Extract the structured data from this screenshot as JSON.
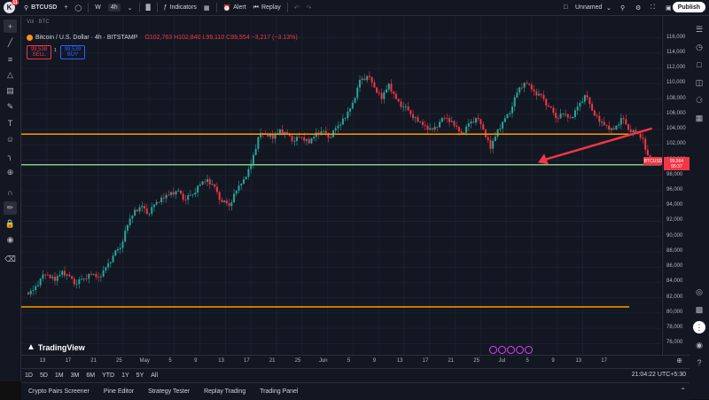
{
  "topbar": {
    "logo_letter": "K",
    "logo_badge": "11",
    "symbol": "BTCUSD",
    "tf_w": "W",
    "tf_active": "4h",
    "indicators": "Indicators",
    "alert": "Alert",
    "replay": "Replay",
    "layout_name": "Unnamed",
    "publish": "Publish"
  },
  "legend": {
    "title": "Bitcoin / U.S. Dollar · 4h · BITSTAMP",
    "o": "O102,763",
    "h": "H102,840",
    "l": "L99,110",
    "c": "C99,554 −3,217 (−3.13%)",
    "vol": "Vol · BTC"
  },
  "trade": {
    "sell_price": "99,538",
    "sell_label": "SELL",
    "buy_price": "99,539",
    "buy_label": "BUY",
    "spread": "1"
  },
  "price_axis": {
    "ticks": [
      "116,000",
      "114,000",
      "112,000",
      "110,000",
      "108,000",
      "106,000",
      "104,000",
      "102,000",
      "100,000",
      "98,000",
      "96,000",
      "94,000",
      "92,000",
      "90,000",
      "88,000",
      "86,000",
      "84,000",
      "82,000",
      "80,000",
      "78,000",
      "76,000"
    ]
  },
  "price_tag": {
    "symbol": "BTCUSD",
    "price": "99,564",
    "countdown": "55:37"
  },
  "date_axis": {
    "labels": [
      "13",
      "17",
      "21",
      "25",
      "May",
      "5",
      "9",
      "13",
      "17",
      "21",
      "25",
      "Jun",
      "5",
      "9",
      "13",
      "17",
      "21",
      "25",
      "Jul",
      "5",
      "9",
      "13",
      "17"
    ]
  },
  "range_bar": {
    "ranges": [
      "1D",
      "5D",
      "1M",
      "3M",
      "6M",
      "YTD",
      "1Y",
      "5Y",
      "All"
    ],
    "clock": "21:04:22 UTC+5:30"
  },
  "bottom_tabs": [
    "Crypto Pairs Screener",
    "Pine Editor",
    "Strategy Tester",
    "Replay Trading",
    "Trading Panel"
  ],
  "watermark": "TradingView",
  "colors": {
    "bg": "#131722",
    "up": "#26a69a",
    "down": "#f23645",
    "orange_line": "#ff9800",
    "green_line": "#81c784"
  },
  "chart_data": {
    "type": "candlestick",
    "symbol": "BTCUSD",
    "interval": "4h",
    "ylim": [
      75000,
      117000
    ],
    "horizontal_lines": [
      {
        "price": 103400,
        "color": "#ff9800"
      },
      {
        "price": 99400,
        "color": "#81c784"
      },
      {
        "price": 80800,
        "color": "#ff9800"
      }
    ],
    "arrow": {
      "from": [
        106000,
        103800
      ],
      "to_label": "down"
    },
    "closes": [
      83000,
      84500,
      85000,
      84200,
      85500,
      84800,
      83800,
      84500,
      85000,
      84700,
      86000,
      87500,
      88500,
      91500,
      93500,
      94000,
      93000,
      94500,
      95000,
      95800,
      96000,
      94800,
      95500,
      96800,
      97500,
      96500,
      94500,
      94000,
      96000,
      97500,
      99500,
      103000,
      103500,
      102800,
      104000,
      103500,
      102500,
      103000,
      102200,
      103600,
      103800,
      103000,
      104500,
      105500,
      107500,
      110500,
      111000,
      109500,
      108000,
      110000,
      108000,
      107000,
      106000,
      105000,
      104500,
      104000,
      105000,
      105500,
      104500,
      103500,
      104800,
      105500,
      104000,
      101500,
      104000,
      105500,
      107000,
      109500,
      110000,
      109000,
      108500,
      107000,
      105500,
      106000,
      105500,
      107000,
      108500,
      106500,
      105000,
      104500,
      104000,
      105500,
      104000,
      103500,
      102800,
      99554
    ]
  }
}
